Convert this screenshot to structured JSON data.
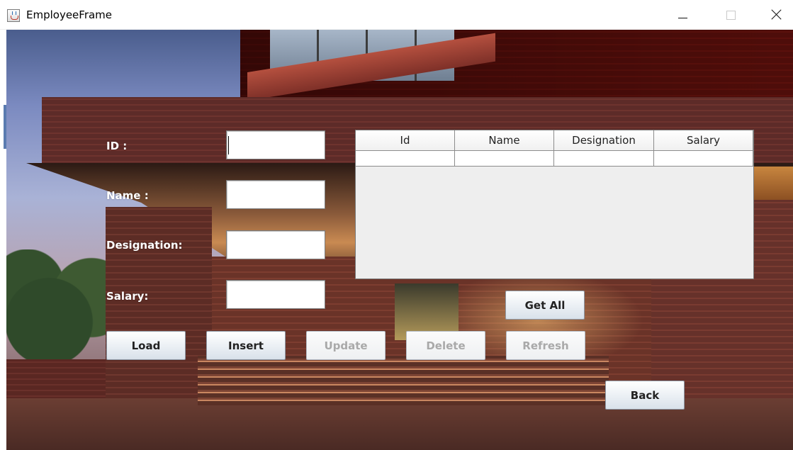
{
  "window": {
    "title": "EmployeeFrame"
  },
  "form": {
    "id_label": "ID :",
    "name_label": "Name :",
    "designation_label": "Designation:",
    "salary_label": "Salary:",
    "id_value": "",
    "name_value": "",
    "designation_value": "",
    "salary_value": ""
  },
  "table": {
    "columns": [
      "Id",
      "Name",
      "Designation",
      "Salary"
    ],
    "rows": [
      [
        "",
        "",
        "",
        ""
      ]
    ]
  },
  "buttons": {
    "get_all": "Get All",
    "load": "Load",
    "insert": "Insert",
    "update": "Update",
    "delete": "Delete",
    "refresh": "Refresh",
    "back": "Back"
  },
  "icons": {
    "app": "java-cup-icon",
    "minimize": "minimize-icon",
    "maximize": "maximize-icon",
    "close": "close-icon"
  }
}
